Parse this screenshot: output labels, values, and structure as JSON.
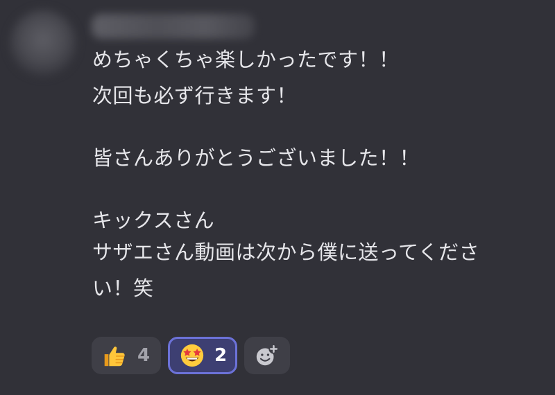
{
  "message": {
    "lines": [
      "めちゃくちゃ楽しかったです！！",
      "次回も必ず行きます！",
      "",
      "皆さんありがとうございました！！",
      "",
      "キックスさん",
      "サザエさん動画は次から僕に送ってくださ",
      "い！笑"
    ]
  },
  "reactions": [
    {
      "emoji": "thumbs-up",
      "count": "4",
      "selected": false
    },
    {
      "emoji": "star-struck",
      "count": "2",
      "selected": true
    }
  ],
  "colors": {
    "background": "#313138",
    "text": "#e6e6ea",
    "reaction_bg": "#3f3f47",
    "reaction_selected_bg": "#3d3f72",
    "reaction_selected_border": "#6c72d8"
  }
}
